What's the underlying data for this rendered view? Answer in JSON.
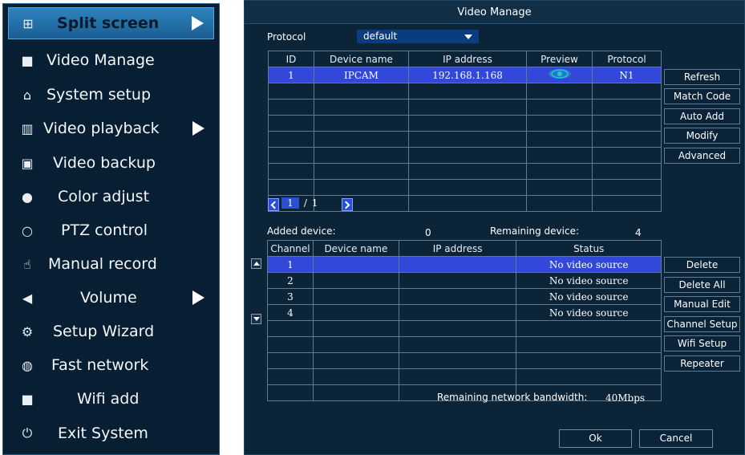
{
  "menu": {
    "items": [
      {
        "label": "Split screen",
        "icon": "grid-icon",
        "glyph": "⊞",
        "submenu": true,
        "active": true
      },
      {
        "label": "Video Manage",
        "icon": "camera-icon",
        "glyph": "■",
        "submenu": false
      },
      {
        "label": "System setup",
        "icon": "home-icon",
        "glyph": "⌂",
        "submenu": false
      },
      {
        "label": "Video playback",
        "icon": "film-icon",
        "glyph": "▥",
        "submenu": true
      },
      {
        "label": "Video backup",
        "icon": "floppy-icon",
        "glyph": "▣",
        "submenu": false
      },
      {
        "label": "Color adjust",
        "icon": "palette-icon",
        "glyph": "●",
        "submenu": false
      },
      {
        "label": "PTZ control",
        "icon": "ptz-icon",
        "glyph": "○",
        "submenu": false
      },
      {
        "label": "Manual record",
        "icon": "hand-icon",
        "glyph": "☝",
        "submenu": false
      },
      {
        "label": "Volume",
        "icon": "speaker-icon",
        "glyph": "◀",
        "submenu": true
      },
      {
        "label": "Setup Wizard",
        "icon": "gears-icon",
        "glyph": "⚙",
        "submenu": false
      },
      {
        "label": "Fast network",
        "icon": "globe-icon",
        "glyph": "◍",
        "submenu": false
      },
      {
        "label": "Wifi add",
        "icon": "camera-icon",
        "glyph": "■",
        "submenu": false
      },
      {
        "label": "Exit System",
        "icon": "power-icon",
        "glyph": "⏻",
        "submenu": false
      }
    ]
  },
  "dialog": {
    "title": "Video Manage",
    "protocol_label": "Protocol",
    "protocol_value": "default",
    "top_table": {
      "headers": [
        "ID",
        "Device name",
        "IP address",
        "Preview",
        "Protocol"
      ],
      "rows": [
        {
          "id": "1",
          "device_name": "IPCAM",
          "ip": "192.168.1.168",
          "preview": "eye-icon",
          "protocol": "N1"
        }
      ],
      "total_rows": 9
    },
    "pager": {
      "current": "1",
      "separator": "/",
      "total": "1"
    },
    "added_label": "Added device:",
    "added_value": "0",
    "remaining_label": "Remaining device:",
    "remaining_value": "4",
    "bottom_table": {
      "headers": [
        "Channel",
        "Device name",
        "IP address",
        "Status"
      ],
      "rows": [
        {
          "channel": "1",
          "status": "No video source"
        },
        {
          "channel": "2",
          "status": "No video source"
        },
        {
          "channel": "3",
          "status": "No video source"
        },
        {
          "channel": "4",
          "status": "No video source"
        }
      ],
      "total_rows": 9
    },
    "bandwidth_label": "Remaining network bandwidth:",
    "bandwidth_value": "40Mbps",
    "top_buttons": [
      "Refresh",
      "Match Code",
      "Auto Add",
      "Modify",
      "Advanced"
    ],
    "bottom_buttons": [
      "Delete",
      "Delete All",
      "Manual Edit",
      "Channel Setup",
      "Wifi Setup",
      "Repeater"
    ],
    "ok_label": "Ok",
    "cancel_label": "Cancel"
  },
  "colors": {
    "menu_bg": "#071e33",
    "dialog_bg": "#0c2437",
    "selected_row": "#3248d8",
    "preview_eye": "#1ec9c9",
    "active_item": "#2d84bf"
  }
}
